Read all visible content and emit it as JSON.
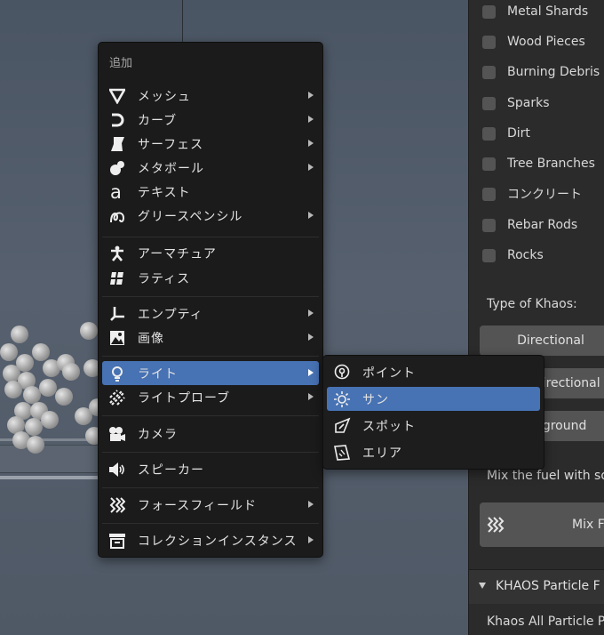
{
  "panel": {
    "checkboxes": [
      {
        "label": "Metal Shards",
        "checked": false
      },
      {
        "label": "Wood Pieces",
        "checked": false
      },
      {
        "label": "Burning Debris",
        "checked": false
      },
      {
        "label": "Sparks",
        "checked": false
      },
      {
        "label": "Dirt",
        "checked": false
      },
      {
        "label": "Tree Branches",
        "checked": false
      },
      {
        "label": "コンクリート",
        "checked": false
      },
      {
        "label": "Rebar Rods",
        "checked": false
      },
      {
        "label": "Rocks",
        "checked": false
      }
    ],
    "type_label": "Type of Khaos:",
    "type_buttons": [
      "Directional",
      "Omnidirectional",
      "360 ground"
    ],
    "mix_label": "Mix the fuel with so",
    "mix_button": "Mix F",
    "section_title": "KHAOS Particle F",
    "bottom_label": "Khaos All Particle P"
  },
  "menu": {
    "title": "追加",
    "items": [
      {
        "label": "メッシュ",
        "icon": "mesh-icon",
        "submenu": true
      },
      {
        "label": "カーブ",
        "icon": "curve-icon",
        "submenu": true
      },
      {
        "label": "サーフェス",
        "icon": "surface-icon",
        "submenu": true
      },
      {
        "label": "メタボール",
        "icon": "metaball-icon",
        "submenu": true
      },
      {
        "label": "テキスト",
        "icon": "text-icon",
        "submenu": false
      },
      {
        "label": "グリースペンシル",
        "icon": "grease-pencil-icon",
        "submenu": true
      },
      {
        "label": "アーマチュア",
        "icon": "armature-icon",
        "submenu": false
      },
      {
        "label": "ラティス",
        "icon": "lattice-icon",
        "submenu": false
      },
      {
        "label": "エンプティ",
        "icon": "empty-icon",
        "submenu": true
      },
      {
        "label": "画像",
        "icon": "image-icon",
        "submenu": true
      },
      {
        "label": "ライト",
        "icon": "light-icon",
        "submenu": true,
        "active": true
      },
      {
        "label": "ライトプローブ",
        "icon": "light-probe-icon",
        "submenu": true
      },
      {
        "label": "カメラ",
        "icon": "camera-icon",
        "submenu": false
      },
      {
        "label": "スピーカー",
        "icon": "speaker-icon",
        "submenu": false
      },
      {
        "label": "フォースフィールド",
        "icon": "force-field-icon",
        "submenu": true
      },
      {
        "label": "コレクションインスタンス",
        "icon": "collection-instance-icon",
        "submenu": true
      }
    ]
  },
  "submenu": {
    "items": [
      {
        "label": "ポイント",
        "icon": "point-light-icon"
      },
      {
        "label": "サン",
        "icon": "sun-light-icon",
        "active": true
      },
      {
        "label": "スポット",
        "icon": "spot-light-icon"
      },
      {
        "label": "エリア",
        "icon": "area-light-icon"
      }
    ]
  },
  "colors": {
    "highlight": "#4772b3",
    "menu_bg": "#1b1b1b",
    "panel_bg": "#2b2b2b"
  }
}
